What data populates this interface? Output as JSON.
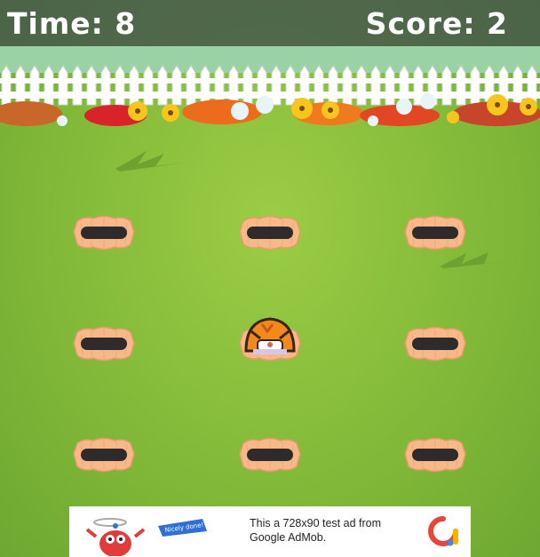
{
  "hud": {
    "time_label": "Time:",
    "time_value": "8",
    "score_label": "Score:",
    "score_value": "2"
  },
  "board": {
    "rows": 3,
    "cols": 3,
    "occupied_hole": "row-2-col-2"
  },
  "ad": {
    "text": "This a 728x90 test ad from Google AdMob.",
    "banner_ribbon": "Nicely done!"
  },
  "colors": {
    "hud_bg": "#3c4650",
    "grass": "#86bd3b",
    "hole_rim": "#f7b98a",
    "hole_dark": "#2f2b2b",
    "mole": "#f08a1c"
  }
}
